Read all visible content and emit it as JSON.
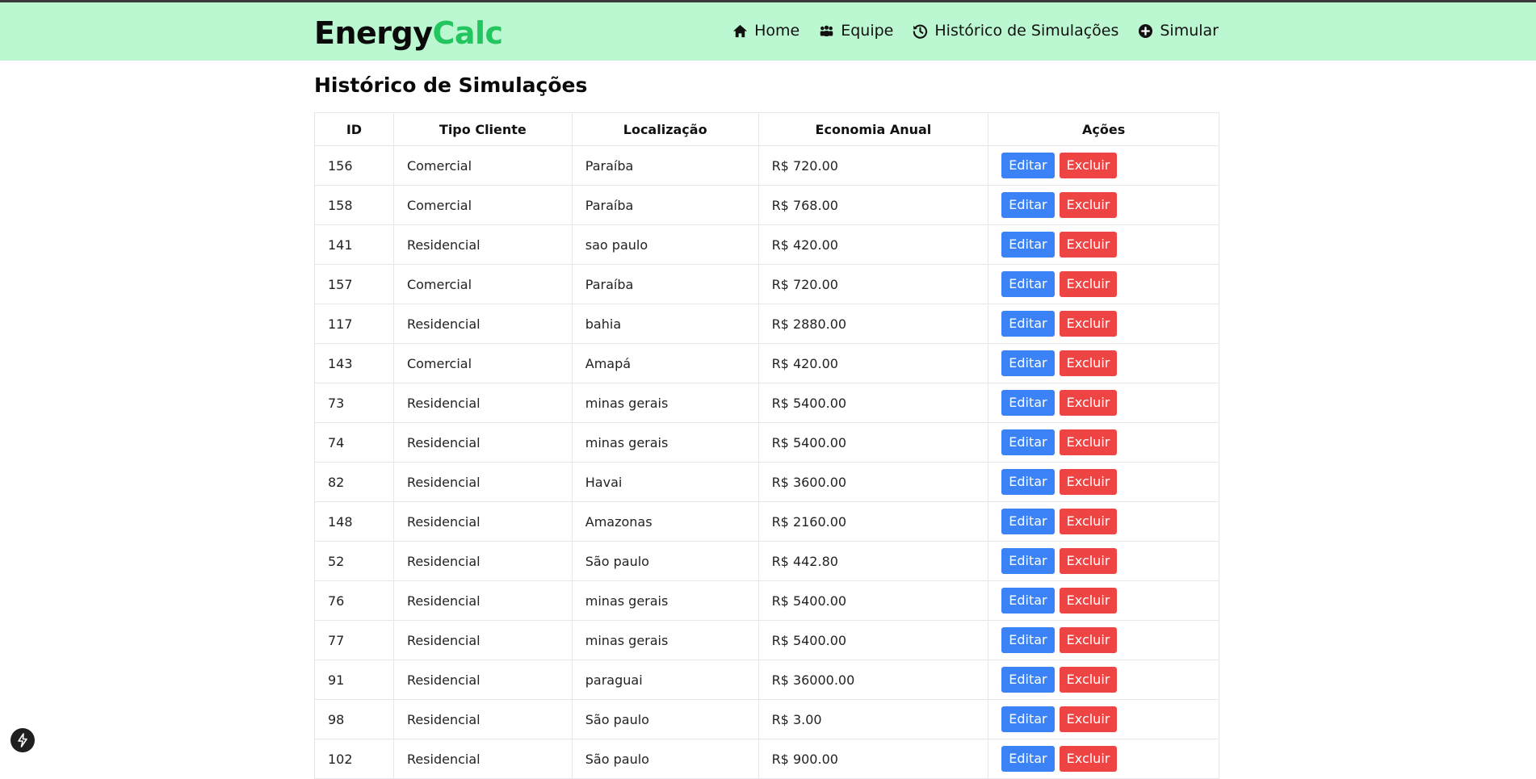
{
  "brand": {
    "part1": "Energy",
    "part2": "Calc"
  },
  "nav": [
    {
      "label": "Home",
      "icon": "home-icon"
    },
    {
      "label": "Equipe",
      "icon": "team-icon"
    },
    {
      "label": "Histórico de Simulações",
      "icon": "history-icon"
    },
    {
      "label": "Simular",
      "icon": "plus-circle-icon"
    }
  ],
  "page": {
    "title": "Histórico de Simulações"
  },
  "table": {
    "headers": [
      "ID",
      "Tipo Cliente",
      "Localização",
      "Economia Anual",
      "Ações"
    ],
    "edit_label": "Editar",
    "delete_label": "Excluir",
    "rows": [
      {
        "id": "156",
        "tipo": "Comercial",
        "loc": "Paraíba",
        "eco": "R$ 720.00"
      },
      {
        "id": "158",
        "tipo": "Comercial",
        "loc": "Paraíba",
        "eco": "R$ 768.00"
      },
      {
        "id": "141",
        "tipo": "Residencial",
        "loc": "sao paulo",
        "eco": "R$ 420.00"
      },
      {
        "id": "157",
        "tipo": "Comercial",
        "loc": "Paraíba",
        "eco": "R$ 720.00"
      },
      {
        "id": "117",
        "tipo": "Residencial",
        "loc": "bahia",
        "eco": "R$ 2880.00"
      },
      {
        "id": "143",
        "tipo": "Comercial",
        "loc": "Amapá",
        "eco": "R$ 420.00"
      },
      {
        "id": "73",
        "tipo": "Residencial",
        "loc": "minas gerais",
        "eco": "R$ 5400.00"
      },
      {
        "id": "74",
        "tipo": "Residencial",
        "loc": "minas gerais",
        "eco": "R$ 5400.00"
      },
      {
        "id": "82",
        "tipo": "Residencial",
        "loc": "Havai",
        "eco": "R$ 3600.00"
      },
      {
        "id": "148",
        "tipo": "Residencial",
        "loc": "Amazonas",
        "eco": "R$ 2160.00"
      },
      {
        "id": "52",
        "tipo": "Residencial",
        "loc": "São paulo",
        "eco": "R$ 442.80"
      },
      {
        "id": "76",
        "tipo": "Residencial",
        "loc": "minas gerais",
        "eco": "R$ 5400.00"
      },
      {
        "id": "77",
        "tipo": "Residencial",
        "loc": "minas gerais",
        "eco": "R$ 5400.00"
      },
      {
        "id": "91",
        "tipo": "Residencial",
        "loc": "paraguai",
        "eco": "R$ 36000.00"
      },
      {
        "id": "98",
        "tipo": "Residencial",
        "loc": "São paulo",
        "eco": "R$ 3.00"
      },
      {
        "id": "102",
        "tipo": "Residencial",
        "loc": "São paulo",
        "eco": "R$ 900.00"
      }
    ]
  },
  "dev_badge_icon": "lightning-icon"
}
